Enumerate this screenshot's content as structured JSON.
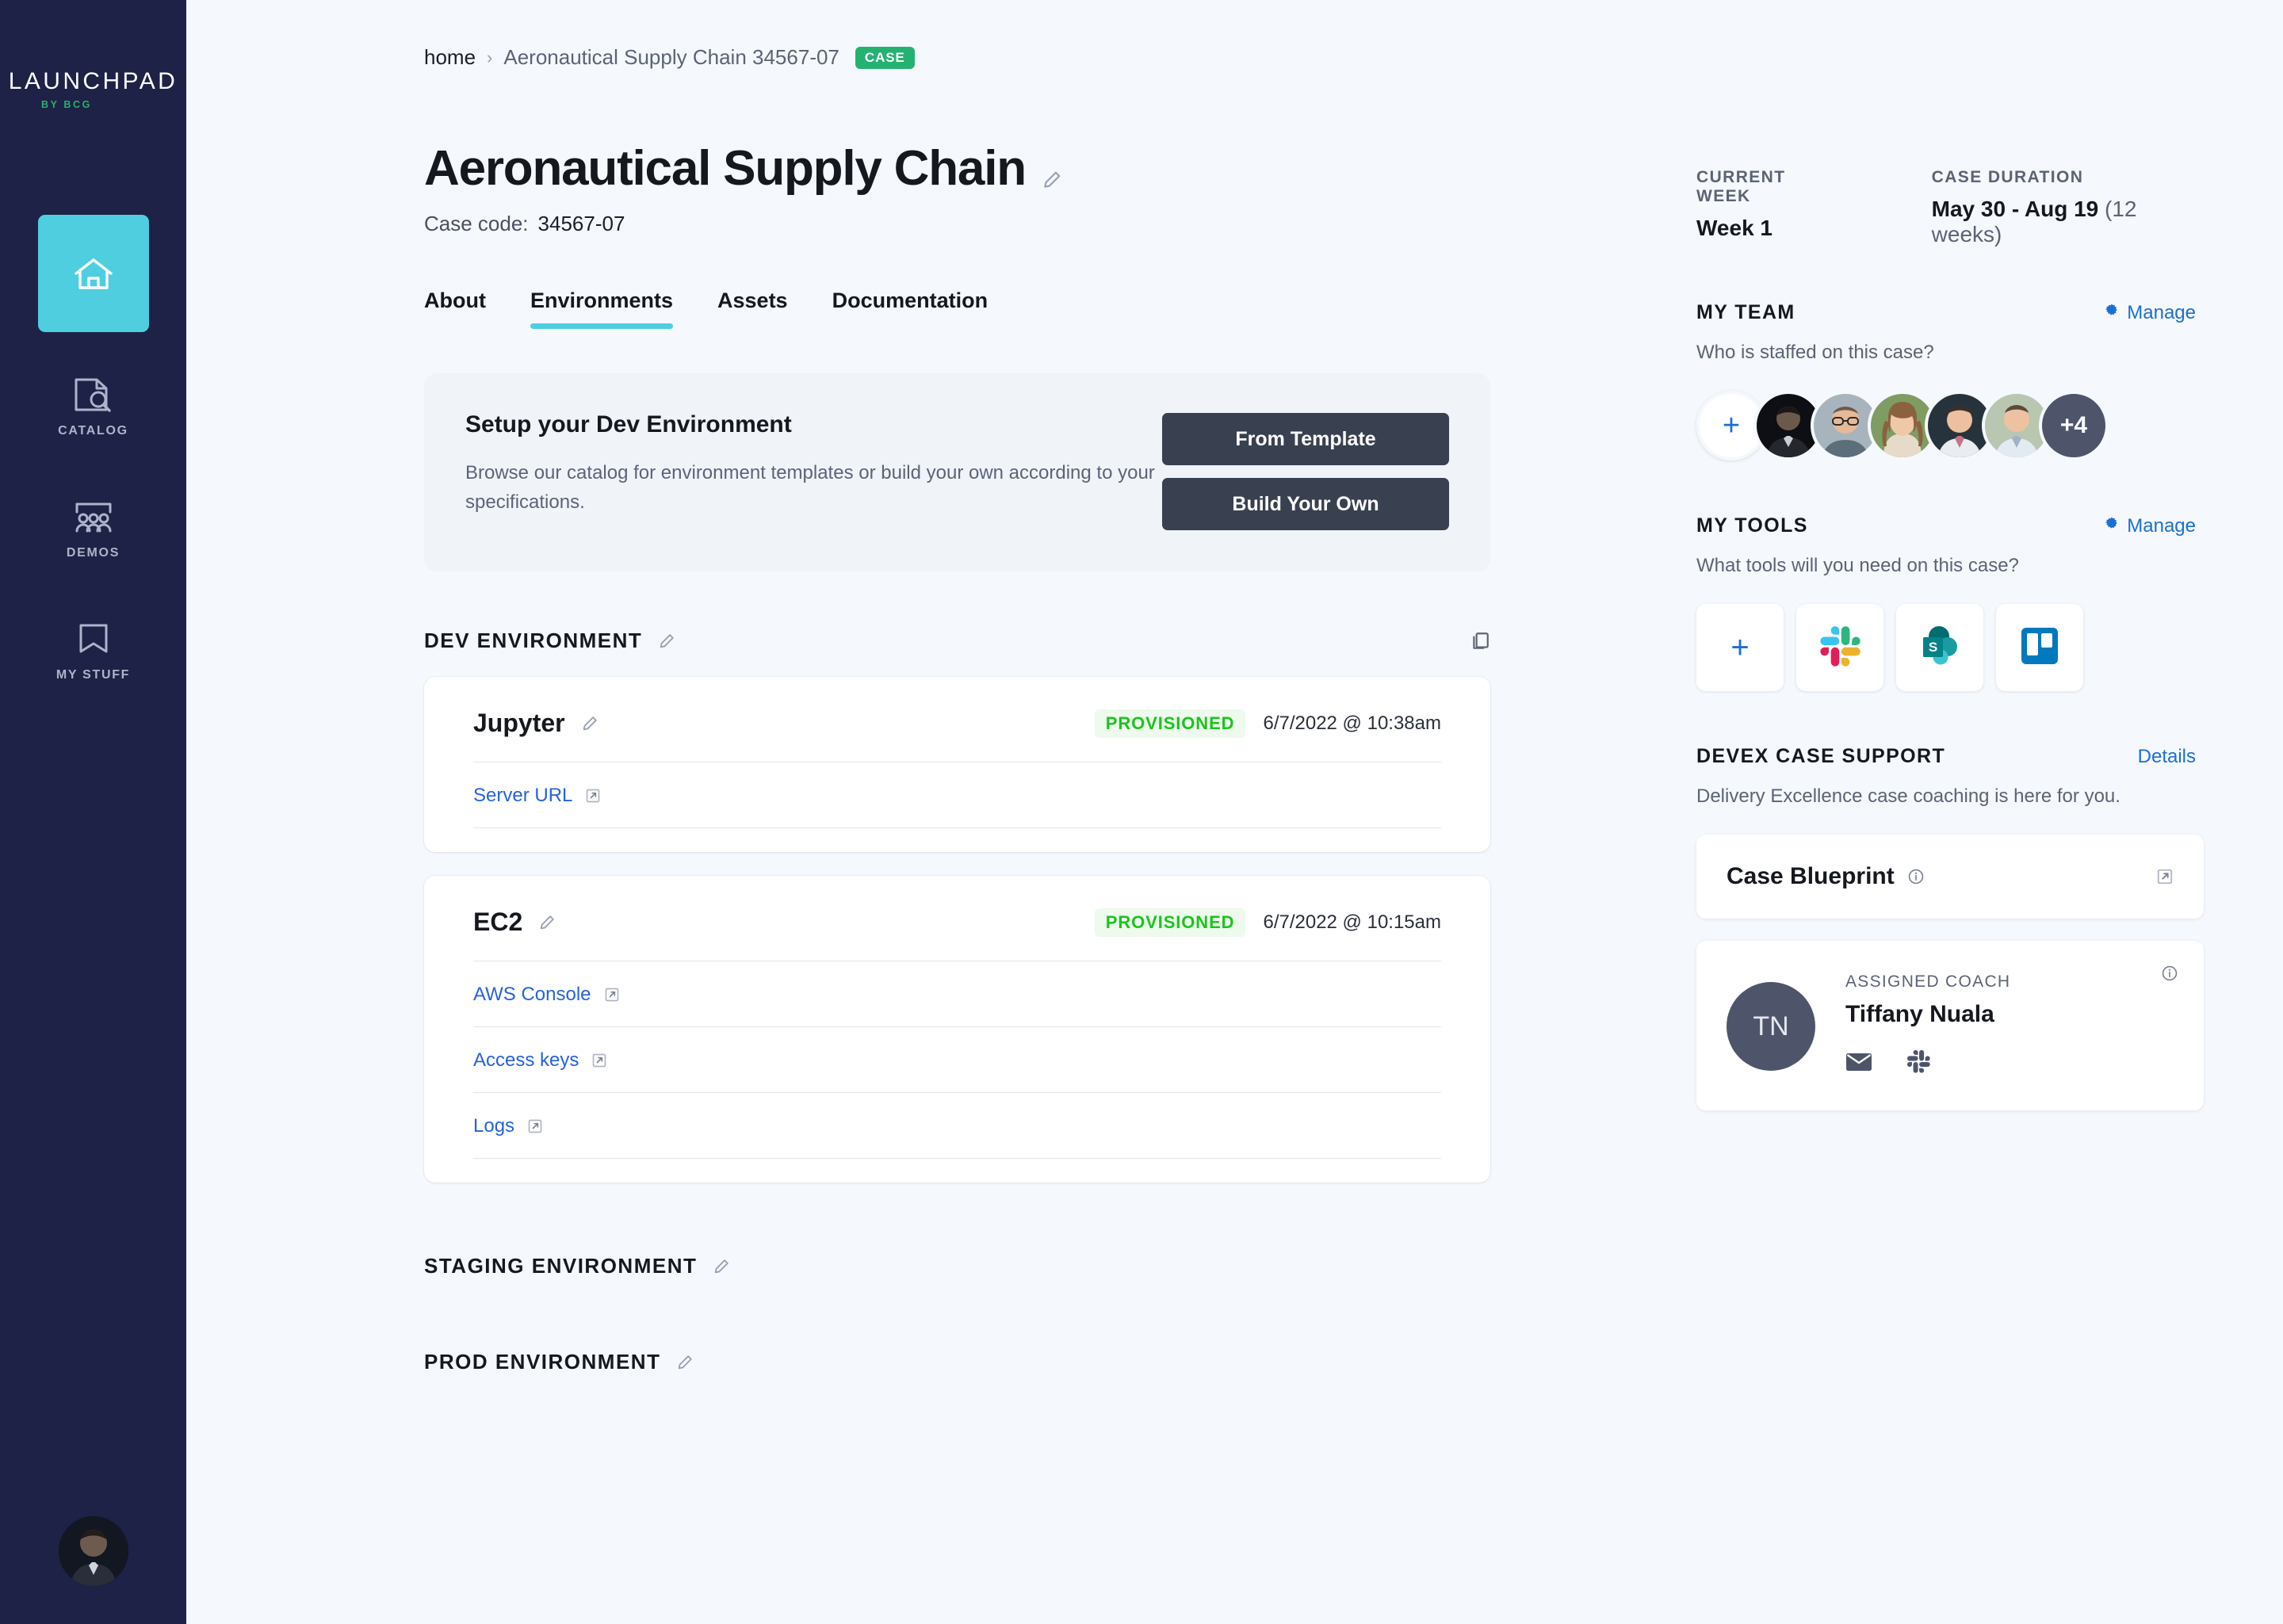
{
  "sidebar": {
    "logo_main": "LAUNCHPAD",
    "logo_sub": "BY BCG",
    "items": [
      {
        "label": "",
        "icon": "home-icon",
        "active": true
      },
      {
        "label": "CATALOG",
        "icon": "catalog-search-icon",
        "active": false
      },
      {
        "label": "DEMOS",
        "icon": "demos-people-icon",
        "active": false
      },
      {
        "label": "MY STUFF",
        "icon": "bookmark-icon",
        "active": false
      }
    ],
    "user_avatar": "user-avatar"
  },
  "breadcrumb": {
    "home": "home",
    "separator": "›",
    "current": "Aeronautical Supply Chain 34567-07",
    "badge": "CASE"
  },
  "header": {
    "title": "Aeronautical Supply Chain",
    "case_code_label": "Case code:",
    "case_code_value": "34567-07"
  },
  "tabs": [
    {
      "label": "About",
      "active": false
    },
    {
      "label": "Environments",
      "active": true
    },
    {
      "label": "Assets",
      "active": false
    },
    {
      "label": "Documentation",
      "active": false
    }
  ],
  "setup": {
    "title": "Setup your Dev Environment",
    "description": "Browse our catalog for environment templates or build your own according to your specifications.",
    "primary_button": "From Template",
    "secondary_button": "Build Your Own"
  },
  "environments": [
    {
      "section_title": "DEV ENVIRONMENT",
      "cards": [
        {
          "name": "Jupyter",
          "status": "PROVISIONED",
          "timestamp": "6/7/2022 @ 10:38am",
          "links": [
            "Server URL"
          ]
        },
        {
          "name": "EC2",
          "status": "PROVISIONED",
          "timestamp": "6/7/2022 @ 10:15am",
          "links": [
            "AWS Console",
            "Access keys",
            "Logs"
          ]
        }
      ]
    },
    {
      "section_title": "STAGING ENVIRONMENT",
      "cards": []
    },
    {
      "section_title": "PROD ENVIRONMENT",
      "cards": []
    }
  ],
  "rail": {
    "current_week_label": "CURRENT WEEK",
    "current_week_value": "Week 1",
    "case_duration_label": "CASE DURATION",
    "case_duration_value": "May 30 - Aug 19",
    "case_duration_weeks": "(12 weeks)",
    "team": {
      "title": "MY TEAM",
      "manage": "Manage",
      "subtitle": "Who is staffed on this case?",
      "add_label": "+",
      "overflow_label": "+4",
      "member_count": 5
    },
    "tools": {
      "title": "MY TOOLS",
      "manage": "Manage",
      "subtitle": "What tools will you need on this case?",
      "add_label": "+",
      "items": [
        "slack-icon",
        "sharepoint-icon",
        "trello-icon"
      ]
    },
    "support": {
      "title": "DEVEX CASE SUPPORT",
      "details": "Details",
      "subtitle": "Delivery Excellence case coaching is here for you.",
      "blueprint_title": "Case Blueprint",
      "coach_label": "ASSIGNED COACH",
      "coach_name": "Tiffany Nuala",
      "coach_initials": "TN"
    }
  },
  "colors": {
    "sidebar_bg": "#1E2246",
    "accent_cyan": "#4FCEE0",
    "accent_green": "#24B273",
    "status_green": "#1BC41B",
    "link_blue": "#2563D9",
    "page_bg": "#F5F8FC"
  }
}
